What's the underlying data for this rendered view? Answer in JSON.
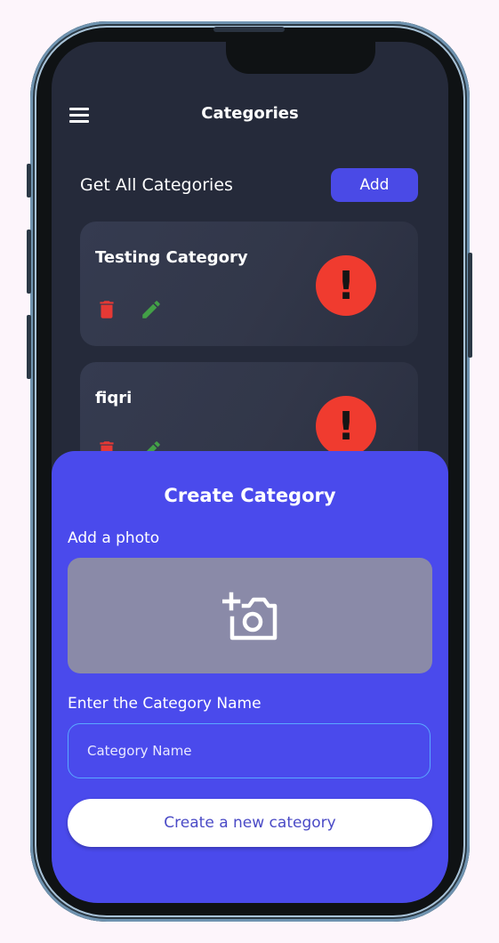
{
  "appbar": {
    "title": "Categories"
  },
  "header": {
    "section_title": "Get All Categories",
    "add_label": "Add"
  },
  "categories": [
    {
      "name": "Testing Category"
    },
    {
      "name": "fiqri"
    }
  ],
  "sheet": {
    "title": "Create Category",
    "photo_label": "Add a photo",
    "name_label": "Enter the Category Name",
    "name_placeholder": "Category Name",
    "name_value": "",
    "submit_label": "Create a new category"
  },
  "icons": {
    "menu": "menu-icon",
    "delete": "trash-icon",
    "edit": "pencil-icon",
    "alert": "alert-icon",
    "photo": "add-photo-icon"
  },
  "colors": {
    "background": "#252a3a",
    "card": "#343a4e",
    "accent": "#4a4aec",
    "alert": "#f03b2f",
    "delete": "#e53935",
    "edit": "#43a047"
  }
}
